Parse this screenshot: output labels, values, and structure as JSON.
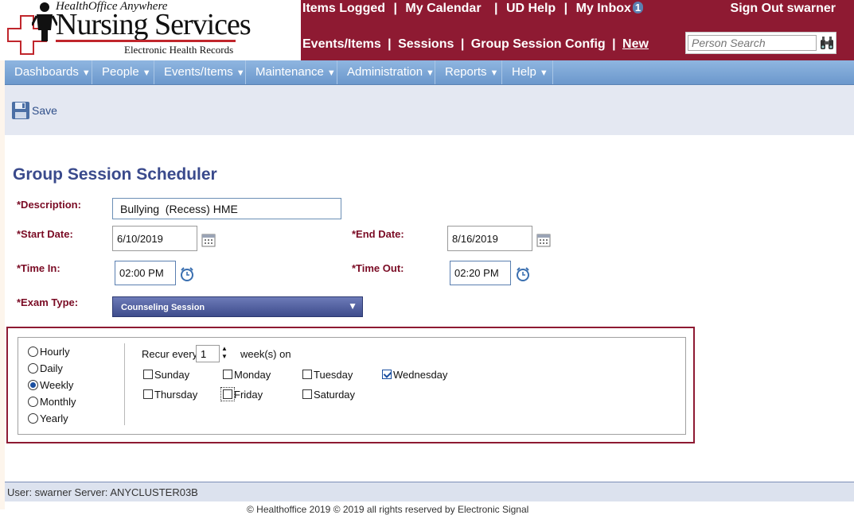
{
  "logo": {
    "top_text": "HealthOffice Anywhere",
    "main_text": "Nursing Services",
    "sub_text": "Electronic Health Records"
  },
  "header": {
    "links": [
      "Items Logged",
      "My Calendar",
      "UD Help",
      "My Inbox"
    ],
    "inbox_count": "1",
    "separator": "|",
    "sign_out": "Sign Out swarner",
    "sublinks": [
      "Events/Items",
      "Sessions",
      "Group Session Config",
      "New"
    ],
    "search_placeholder": "Person Search"
  },
  "menu": {
    "items": [
      "Dashboards",
      "People",
      "Events/Items",
      "Maintenance",
      "Administration",
      "Reports",
      "Help"
    ]
  },
  "toolbar": {
    "save_label": "Save"
  },
  "form": {
    "title": "Group Session Scheduler",
    "description_label": "*Description:",
    "description_value": "Bullying  (Recess) HME",
    "start_date_label": "*Start Date:",
    "start_date_value": "6/10/2019",
    "end_date_label": "*End Date:",
    "end_date_value": "8/16/2019",
    "time_in_label": "*Time In:",
    "time_in_value": "02:00 PM",
    "time_out_label": "*Time Out:",
    "time_out_value": "02:20 PM",
    "exam_type_label": "*Exam Type:",
    "exam_type_value": "Counseling Session"
  },
  "recurrence": {
    "patterns": [
      {
        "label": "Hourly",
        "selected": false
      },
      {
        "label": "Daily",
        "selected": false
      },
      {
        "label": "Weekly",
        "selected": true
      },
      {
        "label": "Monthly",
        "selected": false
      },
      {
        "label": "Yearly",
        "selected": false
      }
    ],
    "recur_every_label": "Recur every",
    "recur_every_value": "1",
    "weeks_on_label": "week(s) on",
    "days": [
      {
        "label": "Sunday",
        "checked": false
      },
      {
        "label": "Monday",
        "checked": false
      },
      {
        "label": "Tuesday",
        "checked": false
      },
      {
        "label": "Wednesday",
        "checked": true
      },
      {
        "label": "Thursday",
        "checked": false
      },
      {
        "label": "Friday",
        "checked": false
      },
      {
        "label": "Saturday",
        "checked": false
      }
    ]
  },
  "footer": {
    "status": "User: swarner  Server: ANYCLUSTER03B",
    "copyright": "© Healthoffice 2019 © 2019 all rights reserved by Electronic Signal"
  },
  "colors": {
    "header_maroon": "#8e1a32",
    "menu_blue": "#6b98cc",
    "title_blue": "#3a4a8c",
    "label_red": "#7a0b24"
  }
}
